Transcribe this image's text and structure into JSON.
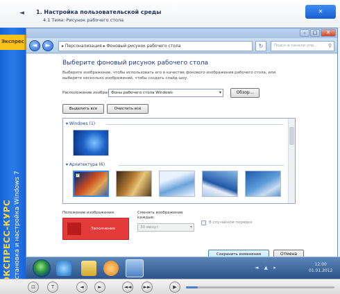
{
  "lesson": {
    "back_arrow": "◄",
    "title": "1. Настройка пользовательской среды",
    "subtitle": "4.1 Тема: Рисунок рабочего стола",
    "close_label": "✕"
  },
  "brand": {
    "tag": "Экспресс",
    "main": "ЭКСПРЕСС-КУРС",
    "sub": "Установка и настройка Windows 7"
  },
  "window": {
    "controls": {
      "minimize": "–",
      "maximize": "□",
      "close": "✕"
    },
    "nav": {
      "back": "◄",
      "forward": "►"
    },
    "address": "▸ Персонализация ▸ Фоновый рисунок рабочего стола",
    "refresh": "↻",
    "search_placeholder": "Поиск в панели упр...",
    "search_icon": "⚲"
  },
  "page": {
    "heading": "Выберите фоновый рисунок рабочего стола",
    "desc_line1": "Выберите изображение, чтобы использовать его в качестве фонового изображения рабочего стола, или",
    "desc_line2": "выберите несколько изображений, чтобы создать слайд-шоу.",
    "location_label": "Расположение изображения:",
    "location_value": "Фоны рабочего стола Windows",
    "location_arrow": "▾",
    "browse_label": "Обзор...",
    "select_all_label": "Выделить все",
    "clear_all_label": "Очистить все"
  },
  "gallery": {
    "groups": [
      {
        "label": "▾ Windows (1)"
      },
      {
        "label": "▾ Архитектура (6)"
      }
    ],
    "checked_mark": "✓"
  },
  "position": {
    "label": "Положение изображения:",
    "preview_text": "Заполнение"
  },
  "slideshow": {
    "interval_label1": "Сменять изображение",
    "interval_label2": "каждые:",
    "interval_value": "30 минут",
    "interval_arrow": "▾",
    "shuffle_label": "В случайном порядке"
  },
  "actions": {
    "save_label": "Сохранить изменения",
    "cancel_label": "Отмена"
  },
  "taskbar": {
    "tray_arrows": "◄ ▲ ▸",
    "clock_time": "12:00",
    "clock_date": "01.01.2012"
  },
  "player": {
    "buttons": [
      "⊡",
      "T",
      "◄",
      "►",
      "◄◄",
      "►►",
      "▶"
    ],
    "progress": 0.08
  },
  "colors": {
    "accent": "#1f63d4",
    "brand_yellow": "#ffd43a",
    "position_preview": "#e33a3a"
  }
}
